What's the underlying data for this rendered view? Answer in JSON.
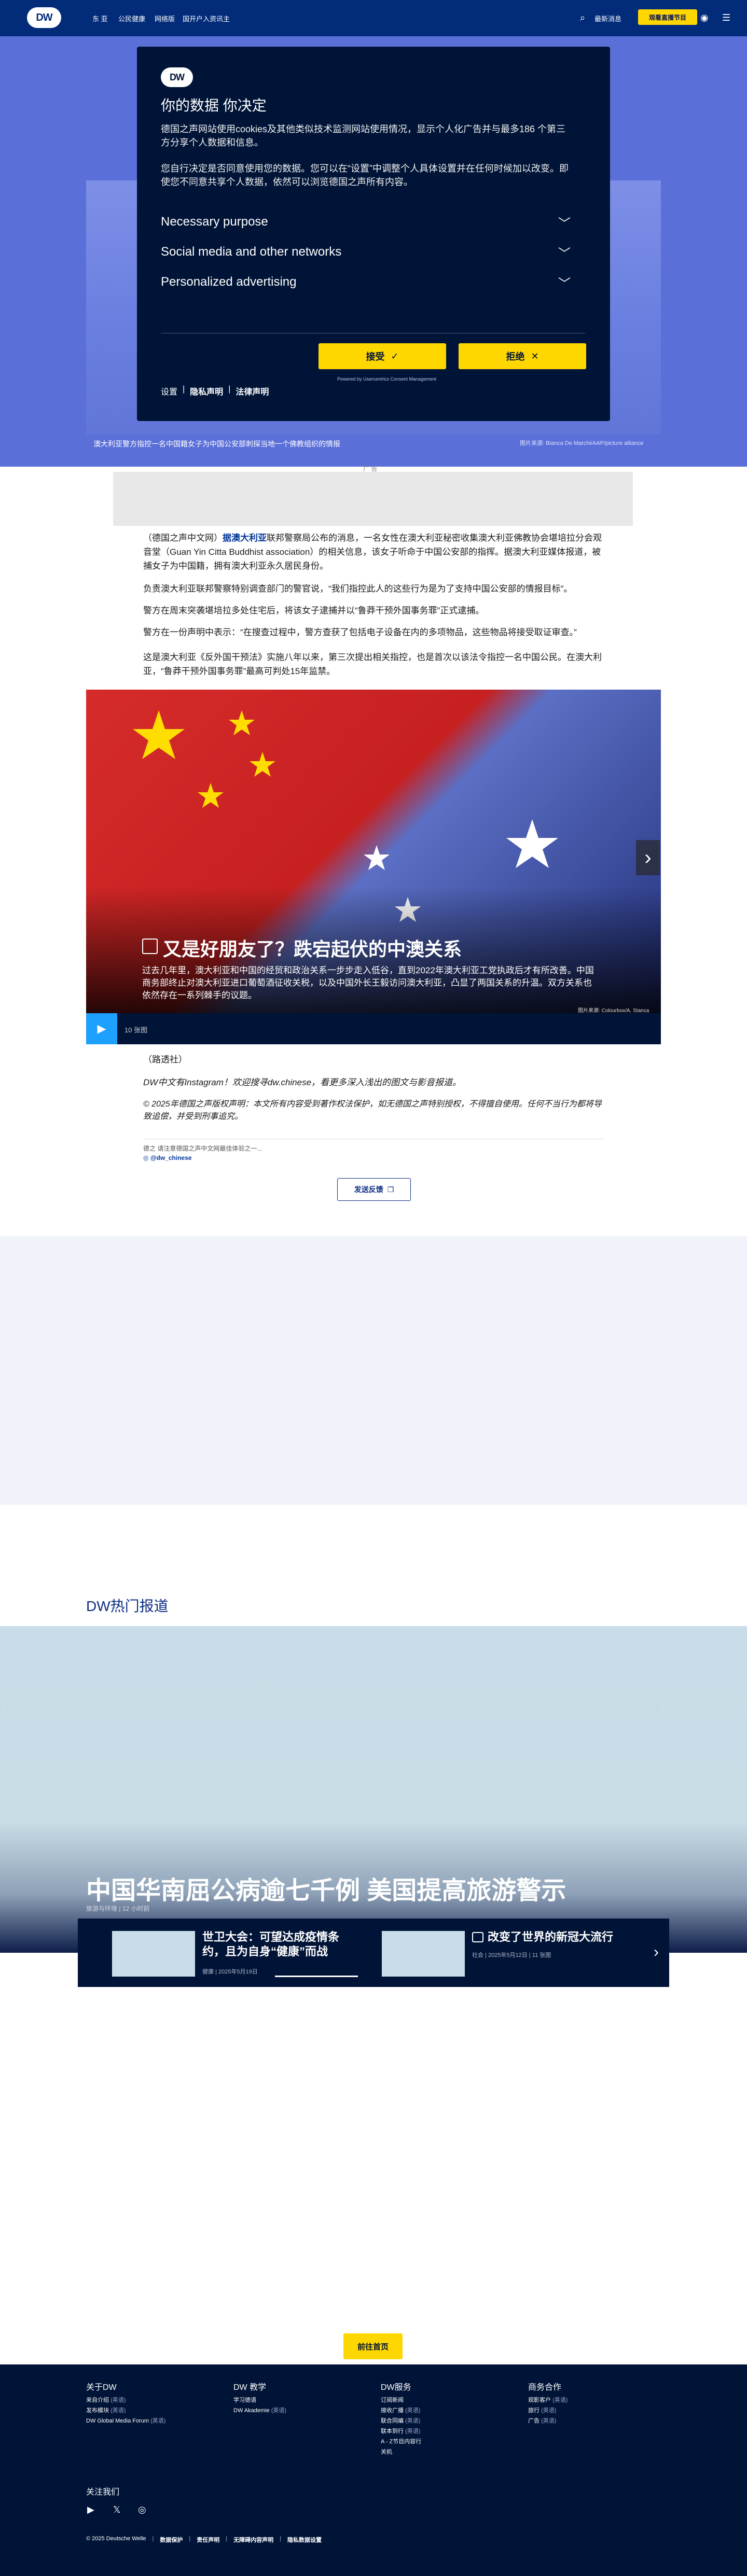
{
  "nav": {
    "logo": "DW",
    "links": [
      "东 亚",
      "公民健康",
      "网络版",
      "国开户入资讯主"
    ],
    "live_label": "观看直播节目",
    "right_link": "最新消息"
  },
  "hero": {
    "caption": "澳大利亚警方指控一名中国籍女子为中国公安部刺探当地一个佛教组织的情报",
    "credit": "图片来源: Bianca De Marchi/AAP/picture alliance",
    "ad_label": "广 告"
  },
  "consent": {
    "logo": "DW",
    "title": "你的数据 你决定",
    "para1": "德国之声网站使用cookies及其他类似技术监测网站使用情况，显示个人化广告并与最多186 个第三方分享个人数据和信息。",
    "para2": "您自行决定是否同意使用您的数据。您可以在“设置”中调整个人具体设置并在任何时候加以改变。即使您不同意共享个人数据，依然可以浏览德国之声所有内容。",
    "accordion": [
      {
        "label": "Necessary purpose"
      },
      {
        "label": "Social media and other networks"
      },
      {
        "label": "Personalized advertising"
      }
    ],
    "accept_label": "接受",
    "reject_label": "拒绝",
    "links": [
      "设置",
      "隐私声明",
      "法律声明"
    ],
    "note": "Powered by Usercentrics Consent Management"
  },
  "article": {
    "p1_prefix": "（德国之声中文网）",
    "p1_link": "据澳大利亚",
    "p1_rest": "联邦警察局公布的消息，一名女性在澳大利亚秘密收集澳大利亚佛教协会堪培拉分会观音堂（Guan Yin Citta Buddhist association）的相关信息，该女子听命于中国公安部的指挥。据澳大利亚媒体报道，被捕女子为中国籍，拥有澳大利亚永久居民身份。",
    "p2": "负责澳大利亚联邦警察特别调查部门的警官说，“我们指控此人的这些行为是为了支持中国公安部的情报目标”。",
    "p3": "警方在周末突袭堪培拉多处住宅后，将该女子逮捕并以“鲁莽干预外国事务罪”正式逮捕。",
    "p4": "警方在一份声明中表示：“在搜查过程中，警方查获了包括电子设备在内的多项物品，这些物品将接受取证审查。”",
    "p5": "这是澳大利亚《反外国干预法》实施八年以来，第三次提出相关指控，也是首次以该法令指控一名中国公民。在澳大利亚，“鲁莽干预外国事务罪”最高可判处15年监禁。",
    "source": "（路透社）",
    "instagram": "DW中文有Instagram！欢迎搜寻dw.chinese，看更多深入浅出的图文与影音报道。",
    "copyright": "© 2025年德国之声版权声明：本文所有内容受到著作权法保护，如无德国之声特别授权，不得擅自使用。任何不当行为都将导致追偿，并受到刑事追究。",
    "share_text": "德之 请注意德国之声中文网最佳体验之一...",
    "handle": "@dw_chinese",
    "share_button": "发送反馈"
  },
  "gallery": {
    "title": "又是好朋友了？跌宕起伏的中澳关系",
    "description": "过去几年里，澳大利亚和中国的经贸和政治关系一步步走入低谷，直到2022年澳大利亚工党执政后才有所改善。中国商务部终止对澳大利亚进口葡萄酒征收关税，以及中国外长王毅访问澳大利亚，凸显了两国关系的升温。双方关系也依然存在一系列棘手的议题。",
    "credit": "图片来源: Colourbox/A. Stanca",
    "count": "10 张图"
  },
  "hot": {
    "section_title": "DW热门报道",
    "headline": "中国华南屈公病逾七千例 美国提高旅游警示",
    "meta": "旅游与环境 | 12 小时前",
    "cards": [
      {
        "title": "世卫大会：可望达成疫情条约，且为自身“健康”而战",
        "meta": "健康 | 2025年5月19日"
      },
      {
        "title": "改变了世界的新冠大流行",
        "meta": "社会 | 2025年5月12日 | 11 张图"
      }
    ]
  },
  "home_button": "前往首页",
  "footer": {
    "columns": [
      {
        "heading": "关于DW",
        "items": [
          {
            "label": "来自介绍",
            "lang": "(英语)"
          },
          {
            "label": "发布模块",
            "lang": "(英语)"
          },
          {
            "label": "DW Global Media Forum",
            "lang": "(英语)"
          }
        ]
      },
      {
        "heading": "DW 教学",
        "items": [
          {
            "label": "学习德语",
            "lang": ""
          },
          {
            "label": "DW Akademie",
            "lang": "(英语)"
          }
        ]
      },
      {
        "heading": "DW服务",
        "items": [
          {
            "label": "订阅新闻",
            "lang": ""
          },
          {
            "label": "接收广播",
            "lang": "(英语)"
          },
          {
            "label": "联合同编",
            "lang": "(英语)"
          },
          {
            "label": "联本到行",
            "lang": "(英语)"
          },
          {
            "label": "A - Z节目内容行",
            "lang": ""
          },
          {
            "label": "关机",
            "lang": ""
          }
        ]
      },
      {
        "heading": "商务合作",
        "items": [
          {
            "label": "观影客户",
            "lang": "(英语)"
          },
          {
            "label": "旅行",
            "lang": "(英语)"
          },
          {
            "label": "广告",
            "lang": "(英语)"
          }
        ]
      }
    ],
    "follow": "关注我们",
    "copyright": "© 2025 Deutsche Welle",
    "bottom_links": [
      "数据保护",
      "责任声明",
      "无障碍内容声明",
      "隐私数据设置"
    ]
  },
  "colors": {
    "brand_blue": "#022b7a",
    "navy": "#001437",
    "yellow": "#ffd700"
  }
}
